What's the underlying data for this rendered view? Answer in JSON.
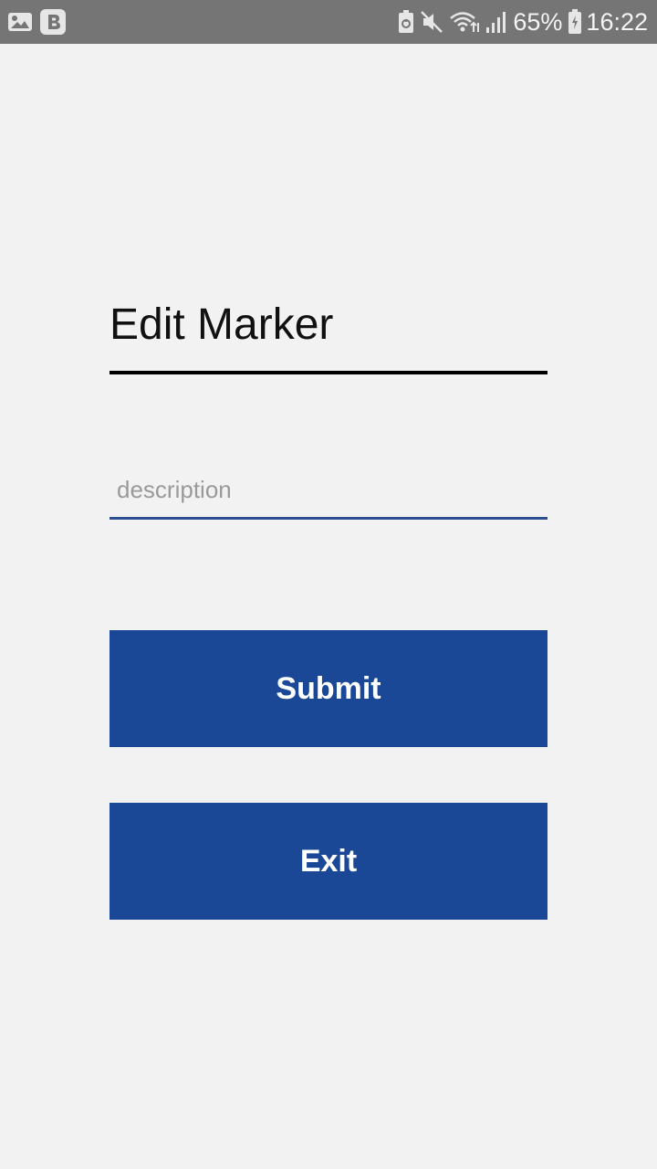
{
  "status_bar": {
    "left_icons": [
      "image-notification-icon",
      "b-app-notification-icon"
    ],
    "right_icons": [
      "battery-saver-icon",
      "mute-icon",
      "wifi-icon",
      "signal-icon"
    ],
    "battery_percent": "65%",
    "time": "16:22",
    "background": "#757575"
  },
  "dialog": {
    "title": "Edit Marker",
    "description_placeholder": "description",
    "description_value": "",
    "submit_label": "Submit",
    "exit_label": "Exit"
  },
  "colors": {
    "background": "#f2f2f2",
    "button": "#1a4897",
    "input_underline": "#2c4f93"
  }
}
